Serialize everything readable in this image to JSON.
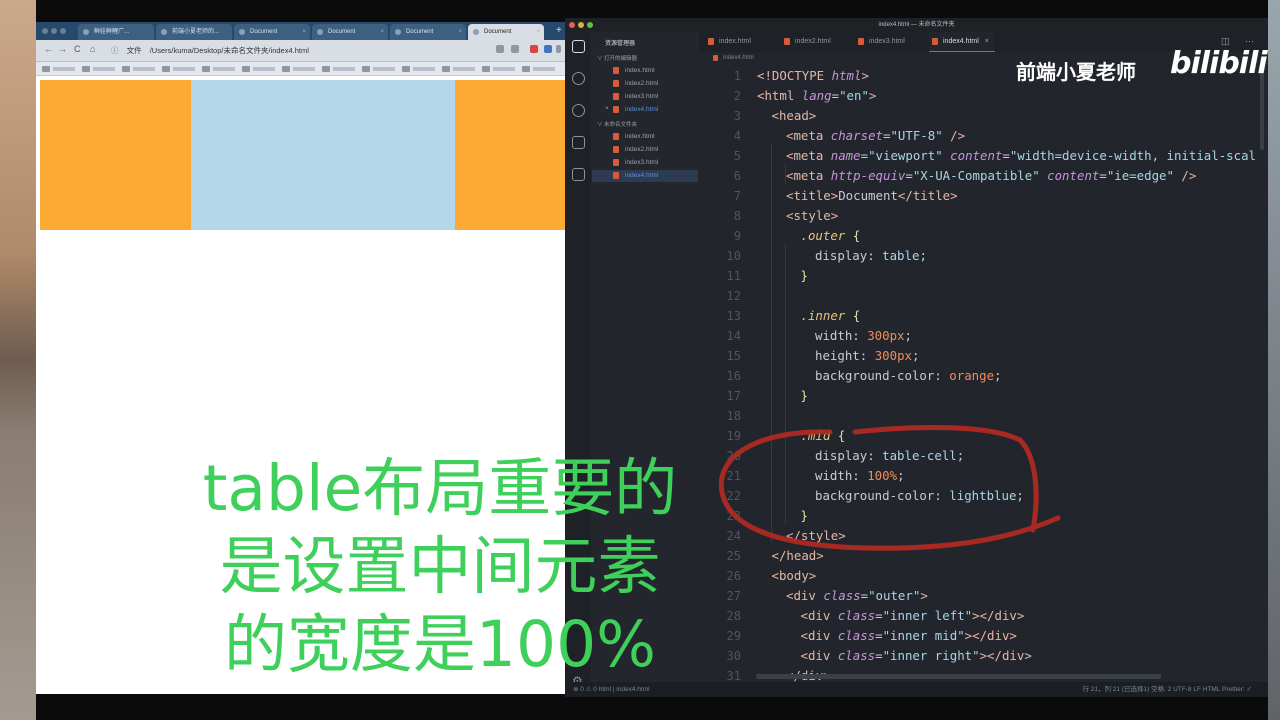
{
  "browser": {
    "tabs": [
      {
        "label": "鲜娃鲜鲤广..."
      },
      {
        "label": "前端小夏老师的..."
      },
      {
        "label": "Document"
      },
      {
        "label": "Document"
      },
      {
        "label": "Document"
      },
      {
        "label": "Document"
      }
    ],
    "new_tab": "+",
    "nav": {
      "back": "←",
      "forward": "→",
      "reload": "C",
      "home": "⌂"
    },
    "url_prefix": "文件",
    "url": "/Users/kuma/Desktop/未命名文件夹/index4.html",
    "page": {
      "colors": {
        "orange": "#fdaa34",
        "lightblue": "#b3d6e9"
      }
    }
  },
  "editor": {
    "window_title": "index4.html — 未命名文件夹",
    "explorer_title": "资源管理器",
    "open_editors_label": "打开的编辑器",
    "open_editors": [
      "index.html",
      "index2.html",
      "index3.html",
      "index4.html"
    ],
    "folder_label": "未命名文件夹",
    "folder_files": [
      "index.html",
      "index2.html",
      "index3.html",
      "index4.html"
    ],
    "tabs": [
      {
        "label": "index.html"
      },
      {
        "label": "index2.html"
      },
      {
        "label": "index3.html"
      },
      {
        "label": "index4.html"
      }
    ],
    "close_x": "×",
    "breadcrumb": "index4.html",
    "line_numbers": [
      "1",
      "2",
      "3",
      "4",
      "5",
      "6",
      "7",
      "8",
      "9",
      "10",
      "11",
      "12",
      "13",
      "14",
      "15",
      "16",
      "17",
      "18",
      "19",
      "20",
      "21",
      "22",
      "23",
      "24",
      "25",
      "26",
      "27",
      "28",
      "29",
      "30",
      "31"
    ],
    "status_left": "⊗ 0 ⚠ 0   html | index4.html",
    "status_right": "行 21，列 21 (已选择1)   空格: 2   UTF-8   LF   HTML   Prettier: ✓"
  },
  "watermark": {
    "name": "前端小夏老师",
    "logo": "bilibili"
  },
  "caption": {
    "line1": "table布局重要的",
    "line2": "是设置中间元素",
    "line3": "的宽度是100%"
  }
}
